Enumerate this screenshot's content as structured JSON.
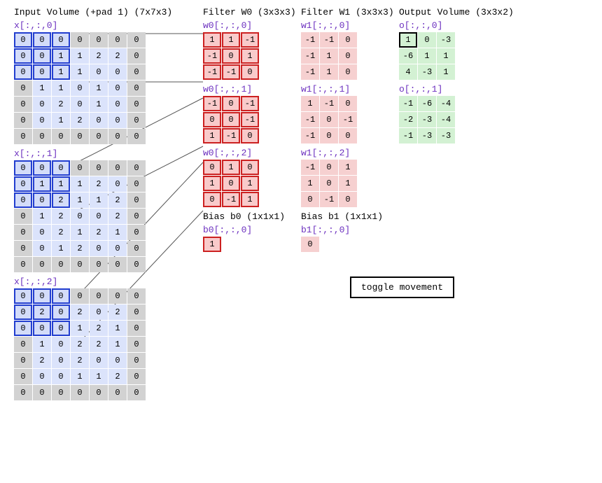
{
  "titles": {
    "input": "Input Volume (+pad 1) (7x7x3)",
    "w0": "Filter W0 (3x3x3)",
    "w1": "Filter W1 (3x3x3)",
    "out": "Output Volume (3x3x2)",
    "bias0": "Bias b0 (1x1x1)",
    "bias1": "Bias b1 (1x1x1)"
  },
  "sub": {
    "x0": "x[:,:,0]",
    "x1": "x[:,:,1]",
    "x2": "x[:,:,2]",
    "w00": "w0[:,:,0]",
    "w01": "w0[:,:,1]",
    "w02": "w0[:,:,2]",
    "w10": "w1[:,:,0]",
    "w11": "w1[:,:,1]",
    "w12": "w1[:,:,2]",
    "o0": "o[:,:,0]",
    "o1": "o[:,:,1]",
    "b0": "b0[:,:,0]",
    "b1": "b1[:,:,0]"
  },
  "input": {
    "d0": [
      [
        0,
        0,
        0,
        0,
        0,
        0,
        0
      ],
      [
        0,
        0,
        1,
        1,
        2,
        2,
        0
      ],
      [
        0,
        0,
        1,
        1,
        0,
        0,
        0
      ],
      [
        0,
        1,
        1,
        0,
        1,
        0,
        0
      ],
      [
        0,
        0,
        2,
        0,
        1,
        0,
        0
      ],
      [
        0,
        0,
        1,
        2,
        0,
        0,
        0
      ],
      [
        0,
        0,
        0,
        0,
        0,
        0,
        0
      ]
    ],
    "d1": [
      [
        0,
        0,
        0,
        0,
        0,
        0,
        0
      ],
      [
        0,
        1,
        1,
        1,
        2,
        0,
        0
      ],
      [
        0,
        0,
        2,
        1,
        1,
        2,
        0
      ],
      [
        0,
        1,
        2,
        0,
        0,
        2,
        0
      ],
      [
        0,
        0,
        2,
        1,
        2,
        1,
        0
      ],
      [
        0,
        0,
        1,
        2,
        0,
        0,
        0
      ],
      [
        0,
        0,
        0,
        0,
        0,
        0,
        0
      ]
    ],
    "d2": [
      [
        0,
        0,
        0,
        0,
        0,
        0,
        0
      ],
      [
        0,
        2,
        0,
        2,
        0,
        2,
        0
      ],
      [
        0,
        0,
        0,
        1,
        2,
        1,
        0
      ],
      [
        0,
        1,
        0,
        2,
        2,
        1,
        0
      ],
      [
        0,
        2,
        0,
        2,
        0,
        0,
        0
      ],
      [
        0,
        0,
        0,
        1,
        1,
        2,
        0
      ],
      [
        0,
        0,
        0,
        0,
        0,
        0,
        0
      ]
    ]
  },
  "w0": {
    "d0": [
      [
        1,
        1,
        -1
      ],
      [
        -1,
        0,
        1
      ],
      [
        -1,
        -1,
        0
      ]
    ],
    "d1": [
      [
        -1,
        0,
        -1
      ],
      [
        0,
        0,
        -1
      ],
      [
        1,
        -1,
        0
      ]
    ],
    "d2": [
      [
        0,
        1,
        0
      ],
      [
        1,
        0,
        1
      ],
      [
        0,
        -1,
        1
      ]
    ]
  },
  "w1": {
    "d0": [
      [
        -1,
        -1,
        0
      ],
      [
        -1,
        1,
        0
      ],
      [
        -1,
        1,
        0
      ]
    ],
    "d1": [
      [
        1,
        -1,
        0
      ],
      [
        -1,
        0,
        -1
      ],
      [
        -1,
        0,
        0
      ]
    ],
    "d2": [
      [
        -1,
        0,
        1
      ],
      [
        1,
        0,
        1
      ],
      [
        0,
        -1,
        0
      ]
    ]
  },
  "out": {
    "d0": [
      [
        1,
        0,
        -3
      ],
      [
        -6,
        1,
        1
      ],
      [
        4,
        -3,
        1
      ]
    ],
    "d1": [
      [
        -1,
        -6,
        -4
      ],
      [
        -2,
        -3,
        -4
      ],
      [
        -1,
        -3,
        -3
      ]
    ]
  },
  "bias": {
    "b0": 1,
    "b1": 0
  },
  "ui": {
    "toggle": "toggle movement"
  },
  "selection": {
    "input_rows": [
      0,
      1,
      2
    ],
    "input_cols": [
      0,
      1,
      2
    ],
    "out_row": 0,
    "out_col": 0
  }
}
